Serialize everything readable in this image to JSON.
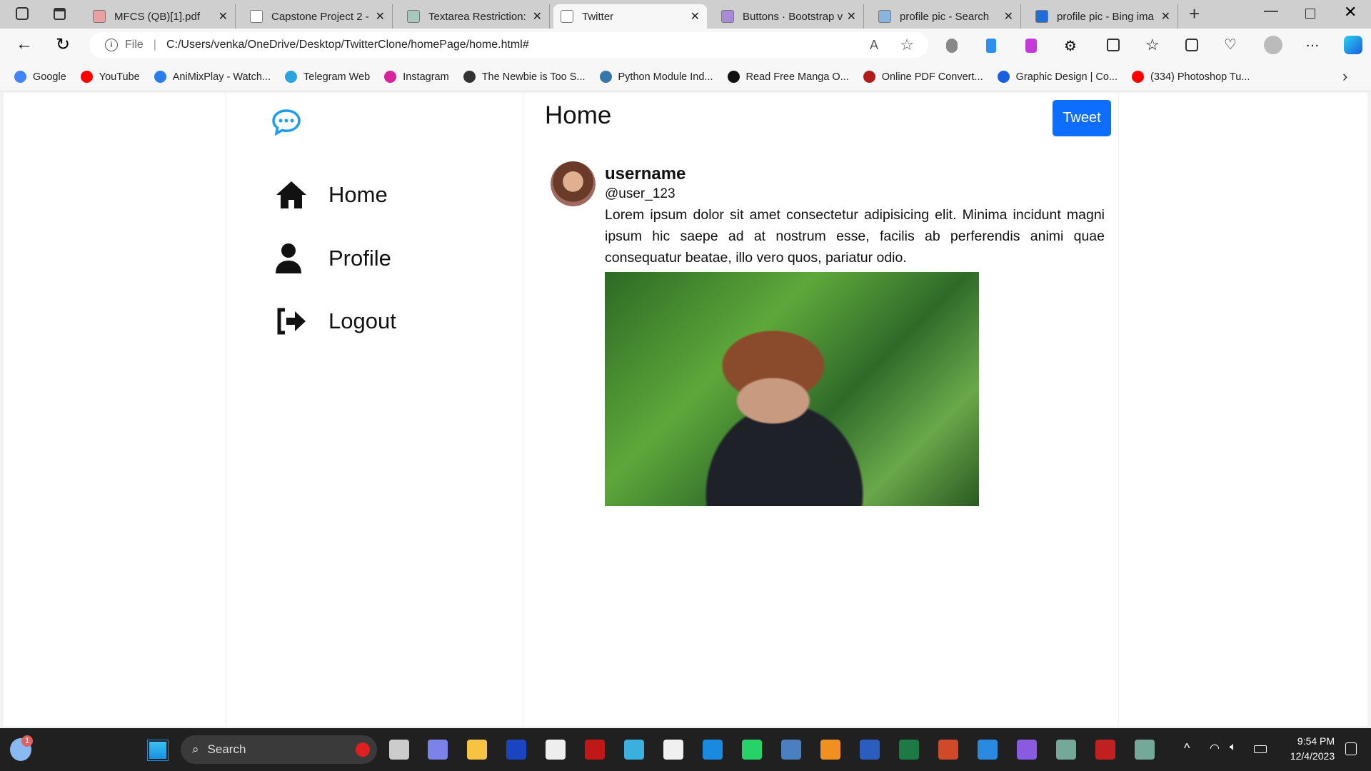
{
  "browser": {
    "tabs": [
      {
        "title": "MFCS (QB)[1].pdf",
        "icon": "pdf-icon",
        "color": "#e8a0a0"
      },
      {
        "title": "Capstone Project 2 -",
        "icon": "page-icon",
        "color": "#ffffff"
      },
      {
        "title": "Textarea Restriction: I",
        "icon": "chatgpt-icon",
        "color": "#a8c8bc"
      },
      {
        "title": "Twitter",
        "icon": "page-icon",
        "color": "#ffffff",
        "active": true
      },
      {
        "title": "Buttons · Bootstrap v",
        "icon": "bootstrap-icon",
        "color": "#a78bd8"
      },
      {
        "title": "profile pic - Search",
        "icon": "search-icon",
        "color": "#8ab4e0"
      },
      {
        "title": "profile pic - Bing ima",
        "icon": "search-icon",
        "color": "#1e6ed8"
      }
    ],
    "address": {
      "scheme": "File",
      "url": "C:/Users/venka/OneDrive/Desktop/TwitterClone/homePage/home.html#"
    },
    "bookmarks": [
      {
        "label": "Google",
        "color": "#4285f4"
      },
      {
        "label": "YouTube",
        "color": "#ff0000"
      },
      {
        "label": "AniMixPlay - Watch...",
        "color": "#2b7de9"
      },
      {
        "label": "Telegram Web",
        "color": "#2aa3e0"
      },
      {
        "label": "Instagram",
        "color": "#d6249f"
      },
      {
        "label": "The Newbie is Too S...",
        "color": "#333333"
      },
      {
        "label": "Python Module Ind...",
        "color": "#3776ab"
      },
      {
        "label": "Read Free Manga O...",
        "color": "#111111"
      },
      {
        "label": "Online PDF Convert...",
        "color": "#b01c1c"
      },
      {
        "label": "Graphic Design | Co...",
        "color": "#1a5fe0"
      },
      {
        "label": "(334) Photoshop Tu...",
        "color": "#ff0000"
      }
    ]
  },
  "app": {
    "accent": "#1d9bf0",
    "nav": [
      {
        "label": "Home",
        "icon": "home-icon"
      },
      {
        "label": "Profile",
        "icon": "user-icon"
      },
      {
        "label": "Logout",
        "icon": "logout-icon"
      }
    ],
    "header_title": "Home",
    "tweet_button": "Tweet",
    "post": {
      "username": "username",
      "handle": "@user_123",
      "text": "Lorem ipsum dolor sit amet consectetur adipisicing elit. Minima incidunt magni ipsum hic saepe ad at nostrum esse, facilis ab perferendis animi quae consequatur beatae, illo vero quos, pariatur odio."
    }
  },
  "taskbar": {
    "search": "Search",
    "time": "9:54 PM",
    "date": "12/4/2023",
    "weather_badge": "1"
  }
}
